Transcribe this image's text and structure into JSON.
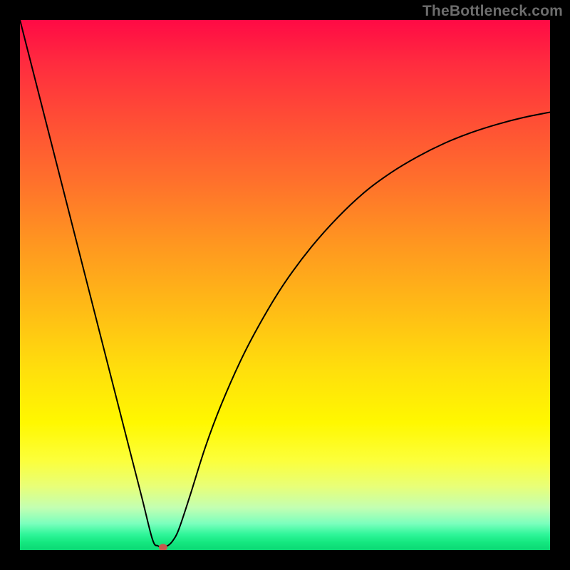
{
  "watermark": "TheBottleneck.com",
  "chart_data": {
    "type": "line",
    "title": "",
    "xlabel": "",
    "ylabel": "",
    "xlim": [
      0,
      100
    ],
    "ylim": [
      0,
      100
    ],
    "grid": false,
    "legend": false,
    "series": [
      {
        "name": "curve",
        "color": "#000000",
        "x": [
          0,
          5,
          10,
          15,
          20,
          23,
          25,
          26,
          26.5,
          27,
          28,
          29,
          30,
          32,
          35,
          38,
          42,
          46,
          50,
          55,
          60,
          65,
          70,
          75,
          80,
          85,
          90,
          95,
          100
        ],
        "y": [
          100,
          80.4,
          60.8,
          41.2,
          21.6,
          9.9,
          2.0,
          0.8,
          0.7,
          0.7,
          0.9,
          2.0,
          4.0,
          10.0,
          19.5,
          27.5,
          36.5,
          44.0,
          50.5,
          57.2,
          62.8,
          67.5,
          71.2,
          74.2,
          76.7,
          78.7,
          80.3,
          81.6,
          82.6
        ]
      }
    ],
    "marker": {
      "name": "highlight-point",
      "x": 27,
      "y": 0.5,
      "color": "#c8584d",
      "rx": 6,
      "ry": 5
    },
    "background_gradient": {
      "top_color": "#ff0a45",
      "bottom_color": "#0bd874",
      "stops": [
        "red",
        "orange",
        "yellow",
        "green"
      ]
    }
  }
}
